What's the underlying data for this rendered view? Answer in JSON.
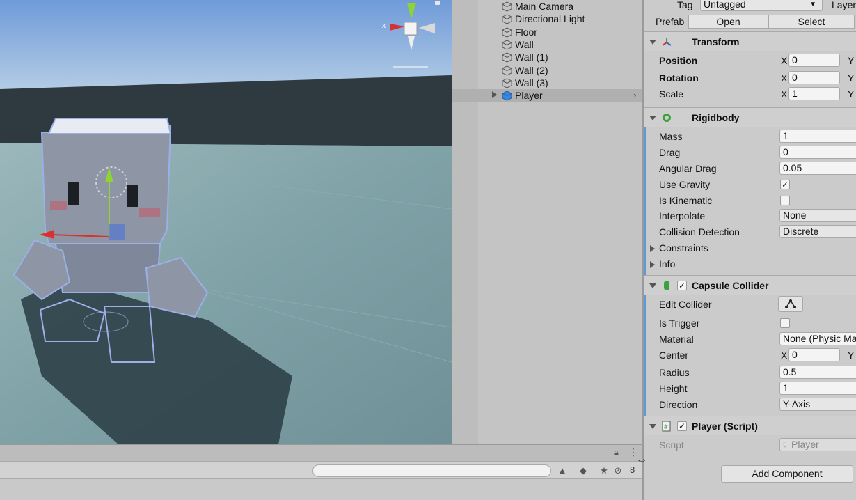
{
  "scene": {
    "gizmo_x_label": "x"
  },
  "hierarchy": {
    "items": [
      {
        "label": "Main Camera"
      },
      {
        "label": "Directional Light"
      },
      {
        "label": "Floor"
      },
      {
        "label": "Wall"
      },
      {
        "label": "Wall (1)"
      },
      {
        "label": "Wall (2)"
      },
      {
        "label": "Wall (3)"
      },
      {
        "label": "Player"
      }
    ],
    "selected_chevron": "›"
  },
  "inspector": {
    "tag_label": "Tag",
    "tag_value": "Untagged",
    "layer_label": "Layer",
    "prefab_label": "Prefab",
    "prefab_open": "Open",
    "prefab_select": "Select",
    "transform": {
      "title": "Transform",
      "position_label": "Position",
      "position_x": "0",
      "rotation_label": "Rotation",
      "rotation_x": "0",
      "scale_label": "Scale",
      "scale_x": "1",
      "axis_x": "X",
      "axis_y": "Y"
    },
    "rigidbody": {
      "title": "Rigidbody",
      "mass_label": "Mass",
      "mass": "1",
      "drag_label": "Drag",
      "drag": "0",
      "angular_drag_label": "Angular Drag",
      "angular_drag": "0.05",
      "use_gravity_label": "Use Gravity",
      "use_gravity_check": "✓",
      "is_kinematic_label": "Is Kinematic",
      "interpolate_label": "Interpolate",
      "interpolate": "None",
      "collision_label": "Collision Detection",
      "collision": "Discrete",
      "constraints_label": "Constraints",
      "info_label": "Info"
    },
    "capsule": {
      "title": "Capsule Collider",
      "enabled_check": "✓",
      "edit_label": "Edit Collider",
      "trigger_label": "Is Trigger",
      "material_label": "Material",
      "material": "None (Physic Ma",
      "center_label": "Center",
      "center_x": "0",
      "radius_label": "Radius",
      "radius": "0.5",
      "height_label": "Height",
      "height": "1",
      "direction_label": "Direction",
      "direction": "Y-Axis"
    },
    "player_script": {
      "title": "Player (Script)",
      "enabled_check": "✓",
      "script_label": "Script",
      "script_value": "Player"
    },
    "add_component": "Add Component"
  },
  "project_bar": {
    "hidden_count": "8"
  },
  "colors": {
    "accent": "#5c9ad6",
    "gizmo_red": "#d93030",
    "gizmo_green": "#8fd430",
    "gizmo_blue": "#4a6fd8"
  }
}
